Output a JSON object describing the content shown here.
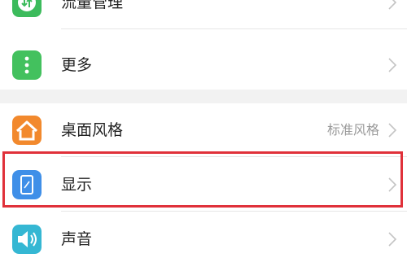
{
  "settings": {
    "items": [
      {
        "label": "流量管理",
        "icon": "traffic-manager-icon",
        "color": "#3cbb5c"
      },
      {
        "label": "更多",
        "icon": "more-dots-icon",
        "color": "#43c15e"
      },
      {
        "label": "桌面风格",
        "icon": "home-icon",
        "color": "#f2892d",
        "value": "标准风格"
      },
      {
        "label": "显示",
        "icon": "display-icon",
        "color": "#3f8fe8"
      },
      {
        "label": "声音",
        "icon": "speaker-icon",
        "color": "#35b7d3"
      }
    ]
  },
  "highlight": {
    "color": "#e0313a",
    "target": "显示"
  }
}
